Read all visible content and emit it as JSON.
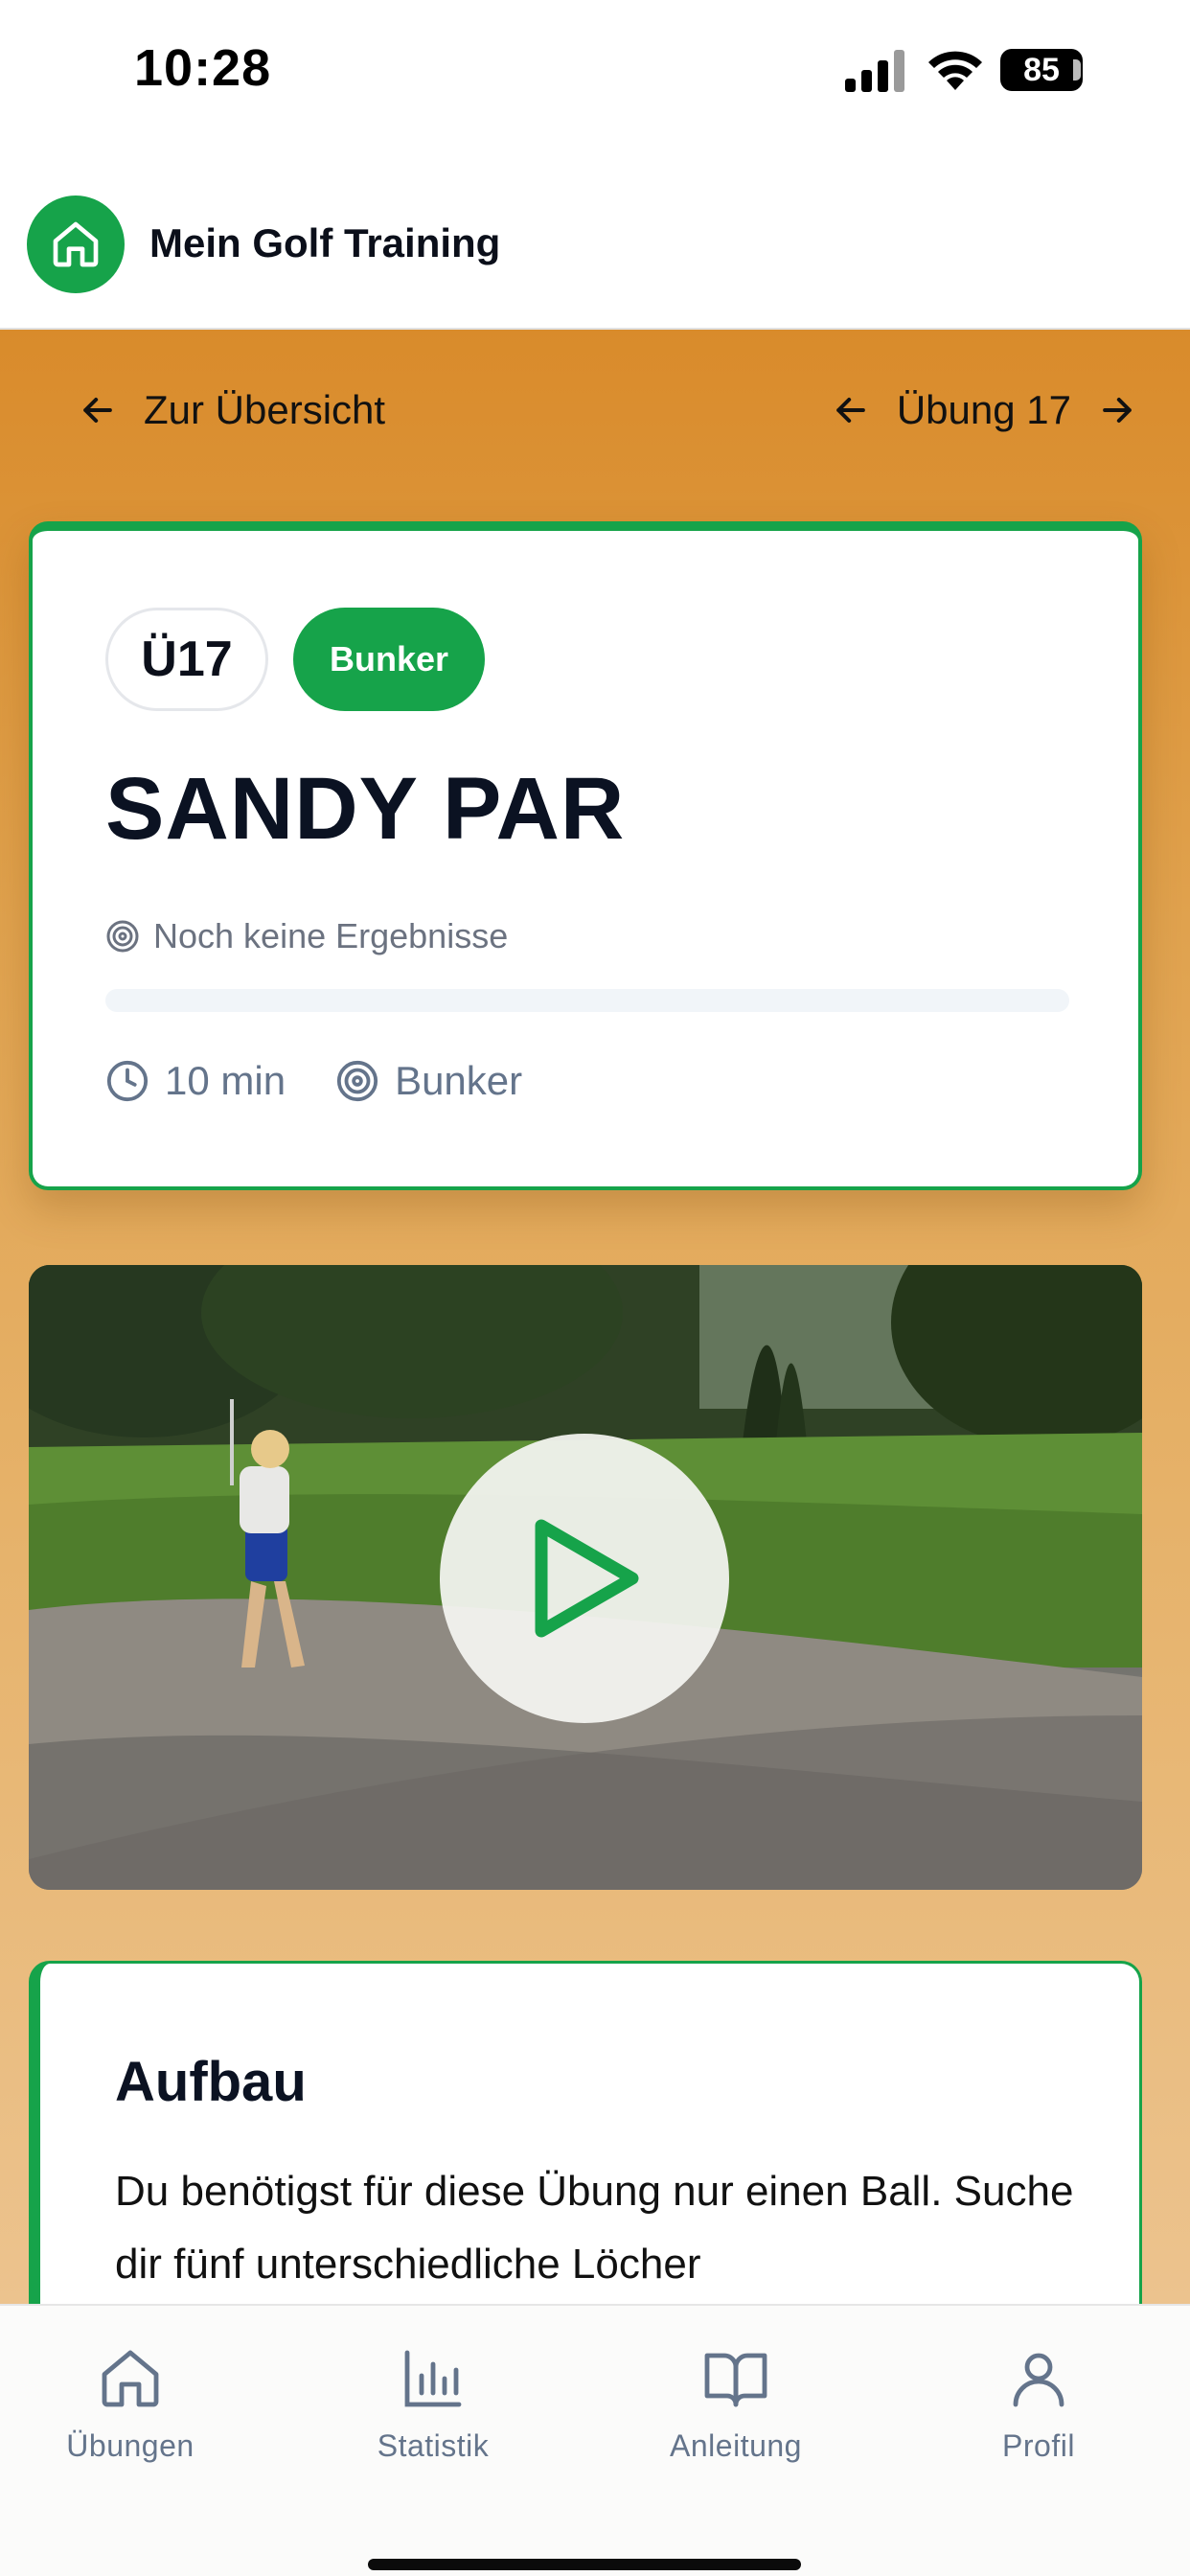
{
  "status_bar": {
    "time": "10:28",
    "battery": "85"
  },
  "header": {
    "title": "Mein Golf Training",
    "logo_icon": "home-icon"
  },
  "nav": {
    "back_label": "Zur Übersicht",
    "exercise_label": "Übung 17"
  },
  "exercise": {
    "code": "Ü17",
    "category": "Bunker",
    "title": "SANDY PAR",
    "results_text": "Noch keine Ergebnisse",
    "progress": 0,
    "duration": "10 min",
    "focus": "Bunker"
  },
  "video": {
    "play_icon": "play-icon"
  },
  "aufbau": {
    "title": "Aufbau",
    "text": "Du benötigst für diese Übung nur einen Ball. Suche dir fünf unterschiedliche Löcher"
  },
  "tabs": [
    {
      "label": "Übungen",
      "icon": "home-icon"
    },
    {
      "label": "Statistik",
      "icon": "bar-chart-icon"
    },
    {
      "label": "Anleitung",
      "icon": "book-icon"
    },
    {
      "label": "Profil",
      "icon": "user-icon"
    }
  ],
  "colors": {
    "accent": "#16a34a",
    "orange": "#d98b2b",
    "muted": "#64748b"
  }
}
